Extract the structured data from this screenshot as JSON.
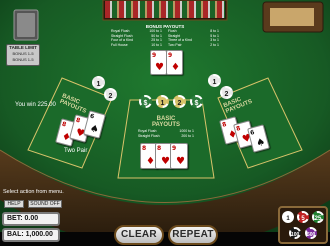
{
  "status": {
    "win_message": "You win 225.00",
    "hand_label": "Two Pair",
    "instruction": "Select action from menu."
  },
  "panel": {
    "help_label": "HELP",
    "sound_label": "SOUND OFF",
    "bet_text": "BET: 0.00",
    "balance_text": "BAL: 1,000.00"
  },
  "buttons": {
    "clear_label": "CLEAR",
    "repeat_label": "REPEAT"
  },
  "table": {
    "bonus_title": "BONUS PAYOUTS",
    "basic_title_1": "BASIC",
    "basic_title_2": "PAYOUTS",
    "table_limit_title": "TABLE LIMIT",
    "table_limit_line1": "BONUS 1-5",
    "table_limit_line2": "BONUS 1-5"
  },
  "paytables": {
    "bonus": [
      {
        "hand": "Royal Flush",
        "pay": "100 to 1"
      },
      {
        "hand": "Straight Flush",
        "pay": "50 to 1"
      },
      {
        "hand": "Four of a Kind",
        "pay": "25 to 1"
      },
      {
        "hand": "Full House",
        "pay": "10 to 1"
      }
    ],
    "bonus_right": [
      {
        "hand": "Flush",
        "pay": "8 to 1"
      },
      {
        "hand": "Straight",
        "pay": "5 to 1"
      },
      {
        "hand": "Three of a Kind",
        "pay": "3 to 1"
      },
      {
        "hand": "Two Pair",
        "pay": "2 to 1"
      }
    ],
    "basic": [
      {
        "hand": "Royal Flush",
        "pay": "1000 to 1"
      },
      {
        "hand": "Straight Flush",
        "pay": "200 to 1"
      }
    ]
  },
  "chips": {
    "spot_labels": [
      "$",
      "1",
      "2",
      "$"
    ],
    "side_labels": [
      "1",
      "2",
      "1",
      "2"
    ],
    "denominations": [
      "1",
      "5",
      "25",
      "100",
      "500"
    ]
  },
  "cards": {
    "top": [
      {
        "rank": "9",
        "suit": "♥",
        "color": "red"
      },
      {
        "rank": "9",
        "suit": "♦",
        "color": "red"
      }
    ],
    "left": [
      {
        "rank": "8",
        "suit": "♦",
        "color": "red"
      },
      {
        "rank": "8",
        "suit": "♥",
        "color": "red"
      },
      {
        "rank": "6",
        "suit": "♠",
        "color": "black"
      }
    ],
    "center": [
      {
        "rank": "8",
        "suit": "♦",
        "color": "red"
      },
      {
        "rank": "8",
        "suit": "♥",
        "color": "red"
      },
      {
        "rank": "9",
        "suit": "♥",
        "color": "red"
      }
    ],
    "right": [
      {
        "rank": "8",
        "suit": "♦",
        "color": "red"
      },
      {
        "rank": "8",
        "suit": "♥",
        "color": "red"
      },
      {
        "rank": "6",
        "suit": "♠",
        "color": "black"
      }
    ]
  },
  "colors": {
    "felt": "#175a24",
    "felt_dark": "#0e3d18",
    "rail": "#3a2412",
    "line_gold": "#d8c36a"
  }
}
